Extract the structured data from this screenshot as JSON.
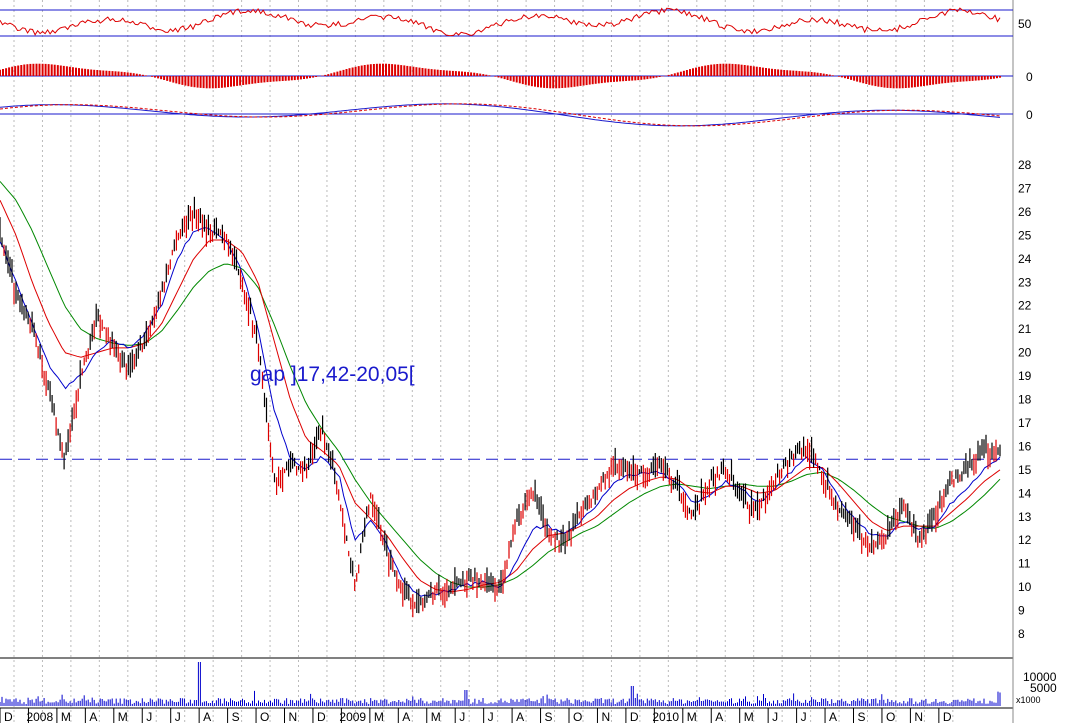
{
  "chart_data": {
    "type": "line",
    "title": "",
    "annotation": "gap ]17,42-20,05[",
    "reference_price": 15.45,
    "colors": {
      "price": "#dd0000",
      "ma_short": "#0000cc",
      "ma_mid": "#dd0000",
      "ma_long": "#008800",
      "reference": "#1a1acc",
      "volume": "#0000cc",
      "oscillator": "#dd0000",
      "grid": "#bbbbbb"
    },
    "months": [
      "D",
      "2008",
      "M",
      "A",
      "M",
      "J",
      "J",
      "A",
      "S",
      "O",
      "N",
      "D",
      "2009",
      "M",
      "A",
      "M",
      "J",
      "J",
      "A",
      "S",
      "O",
      "N",
      "D",
      "2010",
      "M",
      "A",
      "M",
      "J",
      "J",
      "A",
      "S",
      "O",
      "N",
      "D"
    ],
    "price_axis": {
      "min": 8,
      "max": 28,
      "ticks": [
        8,
        9,
        10,
        11,
        12,
        13,
        14,
        15,
        16,
        17,
        18,
        19,
        20,
        21,
        22,
        23,
        24,
        25,
        26,
        27,
        28
      ]
    },
    "volume_axis": {
      "ticks": [
        "10000",
        "5000"
      ],
      "unit": "x1000"
    },
    "indicator_axes": {
      "top": "50",
      "middle": "0",
      "bottom": "0"
    },
    "price_series": {
      "name": "",
      "values": [
        25.0,
        22.5,
        21.0,
        18.5,
        15.3,
        19.0,
        21.5,
        20.5,
        19.2,
        20.5,
        22.5,
        25.0,
        26.0,
        25.2,
        25.0,
        23.0,
        20.5,
        14.5,
        15.2,
        15.0,
        16.8,
        14.0,
        10.0,
        14.0,
        11.5,
        9.8,
        9.2,
        9.8,
        10.0,
        10.3,
        10.2,
        9.9,
        12.8,
        14.2,
        12.3,
        11.8,
        13.2,
        14.0,
        15.2,
        15.0,
        14.8,
        15.2,
        14.2,
        13.0,
        14.5,
        15.0,
        13.8,
        13.2,
        14.6,
        15.5,
        16.0,
        14.8,
        13.2,
        12.5,
        11.8,
        12.2,
        13.5,
        12.0,
        13.0,
        14.5,
        15.0,
        15.7,
        15.9
      ]
    },
    "ma_short": {
      "values": [
        24.8,
        23.0,
        21.2,
        19.5,
        18.5,
        19.0,
        20.0,
        20.5,
        20.2,
        20.8,
        22.0,
        24.0,
        25.2,
        25.3,
        24.8,
        23.5,
        21.0,
        17.5,
        15.5,
        15.0,
        15.6,
        14.8,
        12.0,
        12.8,
        11.8,
        10.3,
        9.6,
        9.7,
        9.9,
        10.1,
        10.2,
        10.0,
        11.0,
        12.5,
        12.6,
        12.2,
        12.8,
        13.5,
        14.4,
        14.8,
        14.8,
        14.9,
        14.4,
        13.6,
        13.9,
        14.5,
        14.2,
        13.6,
        14.1,
        14.9,
        15.5,
        15.1,
        13.8,
        12.9,
        12.2,
        12.2,
        12.8,
        12.5,
        12.6,
        13.6,
        14.3,
        15.0,
        15.5
      ]
    },
    "ma_mid": {
      "values": [
        26.5,
        25.0,
        23.0,
        21.3,
        20.0,
        19.8,
        20.0,
        20.2,
        20.2,
        20.4,
        21.2,
        22.6,
        24.0,
        24.8,
        24.8,
        24.3,
        23.0,
        20.5,
        18.0,
        16.3,
        15.8,
        15.2,
        13.6,
        12.9,
        12.2,
        11.2,
        10.3,
        9.9,
        9.8,
        9.9,
        10.1,
        10.2,
        10.7,
        11.6,
        12.2,
        12.3,
        12.6,
        13.0,
        13.7,
        14.2,
        14.5,
        14.7,
        14.6,
        14.1,
        14.0,
        14.3,
        14.3,
        14.0,
        14.1,
        14.6,
        15.1,
        15.1,
        14.4,
        13.6,
        12.8,
        12.4,
        12.6,
        12.6,
        12.6,
        13.2,
        13.8,
        14.5,
        15.0
      ]
    },
    "ma_long": {
      "values": [
        27.3,
        26.5,
        25.2,
        23.6,
        22.0,
        21.0,
        20.6,
        20.4,
        20.3,
        20.4,
        20.9,
        21.8,
        22.8,
        23.5,
        23.8,
        23.6,
        22.8,
        21.2,
        19.4,
        17.8,
        16.7,
        15.8,
        14.6,
        13.6,
        12.8,
        12.0,
        11.2,
        10.6,
        10.2,
        10.0,
        10.0,
        10.1,
        10.4,
        10.9,
        11.5,
        11.9,
        12.3,
        12.6,
        13.1,
        13.6,
        14.0,
        14.3,
        14.4,
        14.3,
        14.2,
        14.3,
        14.4,
        14.3,
        14.3,
        14.5,
        14.8,
        14.9,
        14.6,
        14.1,
        13.5,
        13.0,
        12.8,
        12.6,
        12.5,
        12.8,
        13.3,
        13.9,
        14.6
      ]
    }
  }
}
